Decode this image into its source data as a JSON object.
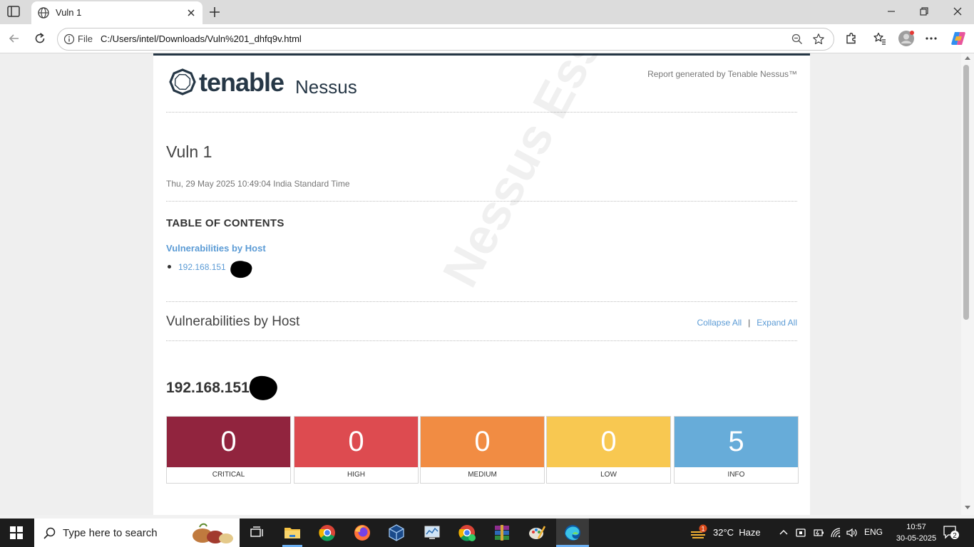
{
  "browser": {
    "tab_title": "Vuln 1",
    "address_label": "File",
    "url": "C:/Users/intel/Downloads/Vuln%201_dhfq9v.html"
  },
  "report": {
    "brand_name": "tenable",
    "brand_product": "Nessus",
    "generated_by": "Report generated by Tenable Nessus™",
    "title": "Vuln 1",
    "date": "Thu, 29 May 2025 10:49:04 India Standard Time",
    "toc_heading": "TABLE OF CONTENTS",
    "toc_link": "Vulnerabilities by Host",
    "toc_items": [
      "192.168.151"
    ],
    "section_title": "Vulnerabilities by Host",
    "collapse_all": "Collapse All",
    "separator": "|",
    "expand_all": "Expand All",
    "host_ip": "192.168.151.",
    "watermark": "Nessus Essentials",
    "severity": [
      {
        "label": "CRITICAL",
        "count": "0",
        "color": "#91243e"
      },
      {
        "label": "HIGH",
        "count": "0",
        "color": "#dd4b50"
      },
      {
        "label": "MEDIUM",
        "count": "0",
        "color": "#f18c43"
      },
      {
        "label": "LOW",
        "count": "0",
        "color": "#f8c851"
      },
      {
        "label": "INFO",
        "count": "5",
        "color": "#67acd9"
      }
    ]
  },
  "taskbar": {
    "search_placeholder": "Type here to search",
    "weather": "32°C  Haze",
    "weather_badge": "1",
    "language": "ENG",
    "time": "10:57",
    "date": "30-05-2025",
    "notification_count": "2"
  }
}
